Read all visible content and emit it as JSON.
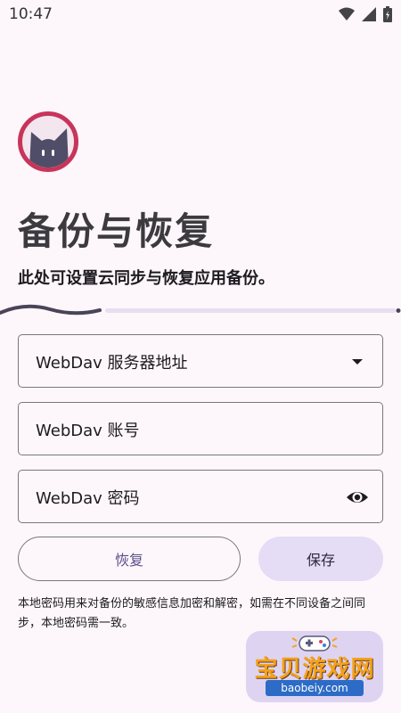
{
  "status_bar": {
    "time": "10:47"
  },
  "header": {
    "title": "备份与恢复",
    "subtitle": "此处可设置云同步与恢复应用备份。"
  },
  "progress": {
    "step_fraction": 0.25
  },
  "form": {
    "server_address": "WebDav 服务器地址",
    "account": "WebDav 账号",
    "password": "WebDav 密码"
  },
  "buttons": {
    "restore_label": "恢复",
    "save_label": "保存"
  },
  "hint": "本地密码用来对备份的敏感信息加密和解密，如需在不同设备之间同步，本地密码需一致。",
  "watermark": {
    "title": "宝贝游戏网",
    "domain": "baobeiy.com"
  },
  "colors": {
    "background": "#fdf7fc",
    "accent": "#4a4458",
    "save_button_bg": "#e5dcf5"
  },
  "icons": [
    "wifi-icon",
    "signal-icon",
    "battery-icon",
    "dropdown-arrow-icon",
    "visibility-icon"
  ]
}
